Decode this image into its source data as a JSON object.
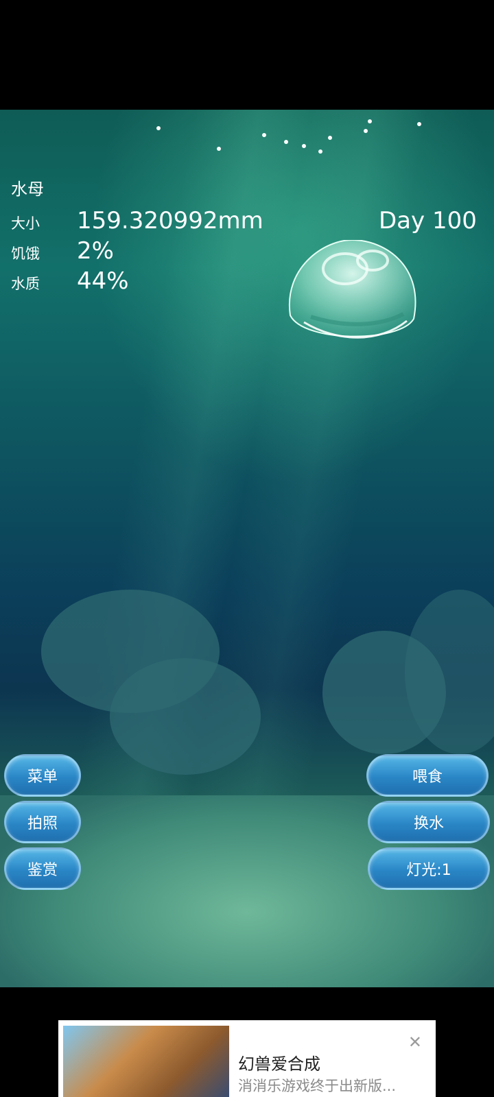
{
  "status": {
    "name_label": "水母",
    "size_label": "大小",
    "size_value": "159.320992mm",
    "hunger_label": "饥饿",
    "hunger_value": "2%",
    "water_label": "水质",
    "water_value": "44%",
    "day": "Day 100"
  },
  "buttons_left": {
    "menu": "菜单",
    "photo": "拍照",
    "appreciate": "鉴赏"
  },
  "buttons_right": {
    "feed": "喂食",
    "change_water": "换水",
    "light": "灯光:1"
  },
  "ad": {
    "title": "幻兽爱合成",
    "subtitle": "消消乐游戏终于出新版...",
    "close_icon": "close-icon"
  },
  "colors": {
    "button_blue": "#2a86c6",
    "water_teal": "#12706a"
  }
}
